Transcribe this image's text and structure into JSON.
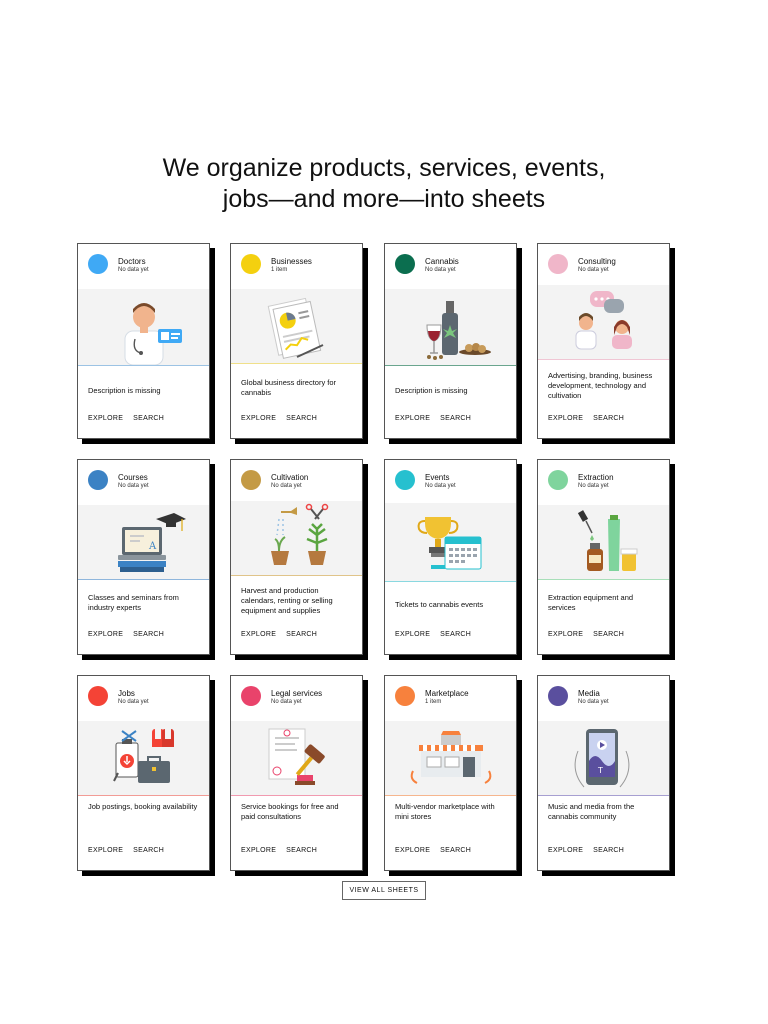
{
  "headline": {
    "line1": "We organize products, services, events,",
    "line2": "jobs—and more—into sheets"
  },
  "cards": [
    {
      "title": "Doctors",
      "count": "No data yet",
      "color": "#3fa9f5",
      "accent": "#9cc3e4",
      "description": "Description is missing",
      "explore": "EXPLORE",
      "search": "SEARCH",
      "icon": "doctor-icon"
    },
    {
      "title": "Businesses",
      "count": "1 item",
      "color": "#f4d00f",
      "accent": "#f0e08a",
      "description": "Global business directory for cannabis",
      "explore": "EXPLORE",
      "search": "SEARCH",
      "icon": "business-report-icon"
    },
    {
      "title": "Cannabis",
      "count": "No data yet",
      "color": "#0b6e4f",
      "accent": "#6aa58e",
      "description": "Description is missing",
      "explore": "EXPLORE",
      "search": "SEARCH",
      "icon": "wine-cannabis-icon"
    },
    {
      "title": "Consulting",
      "count": "No data yet",
      "color": "#f0b6c9",
      "accent": "#f0c6d4",
      "description": "Advertising, branding, business development, technology and cultivation",
      "explore": "EXPLORE",
      "search": "SEARCH",
      "icon": "consulting-icon"
    },
    {
      "title": "Courses",
      "count": "No data yet",
      "color": "#3b82c4",
      "accent": "#8fb6dc",
      "description": "Classes and seminars from industry experts",
      "explore": "EXPLORE",
      "search": "SEARCH",
      "icon": "laptop-graduation-icon"
    },
    {
      "title": "Cultivation",
      "count": "No data yet",
      "color": "#c49a45",
      "accent": "#e0c48a",
      "description": "Harvest and production calendars, renting or selling equipment and supplies",
      "explore": "EXPLORE",
      "search": "SEARCH",
      "icon": "plants-icon"
    },
    {
      "title": "Events",
      "count": "No data yet",
      "color": "#26c0cf",
      "accent": "#8ad8e0",
      "description": "Tickets to cannabis events",
      "explore": "EXPLORE",
      "search": "SEARCH",
      "icon": "trophy-calendar-icon"
    },
    {
      "title": "Extraction",
      "count": "No data yet",
      "color": "#7fd49d",
      "accent": "#a8dfb9",
      "description": "Extraction equipment and services",
      "explore": "EXPLORE",
      "search": "SEARCH",
      "icon": "bottles-icon"
    },
    {
      "title": "Jobs",
      "count": "No data yet",
      "color": "#f44336",
      "accent": "#f29c96",
      "description": "Job postings, booking availability",
      "explore": "EXPLORE",
      "search": "SEARCH",
      "icon": "briefcase-tools-icon"
    },
    {
      "title": "Legal services",
      "count": "No data yet",
      "color": "#e9436b",
      "accent": "#f19ab0",
      "description": "Service bookings for free and paid consultations",
      "explore": "EXPLORE",
      "search": "SEARCH",
      "icon": "gavel-document-icon"
    },
    {
      "title": "Marketplace",
      "count": "1 item",
      "color": "#f7813d",
      "accent": "#f6b68e",
      "description": "Multi-vendor marketplace with mini stores",
      "explore": "EXPLORE",
      "search": "SEARCH",
      "icon": "storefront-icon"
    },
    {
      "title": "Media",
      "count": "No data yet",
      "color": "#5a4f9e",
      "accent": "#a79fd1",
      "description": "Music and media from the cannabis community",
      "explore": "EXPLORE",
      "search": "SEARCH",
      "icon": "media-player-icon"
    }
  ],
  "view_all_label": "VIEW ALL SHEETS"
}
